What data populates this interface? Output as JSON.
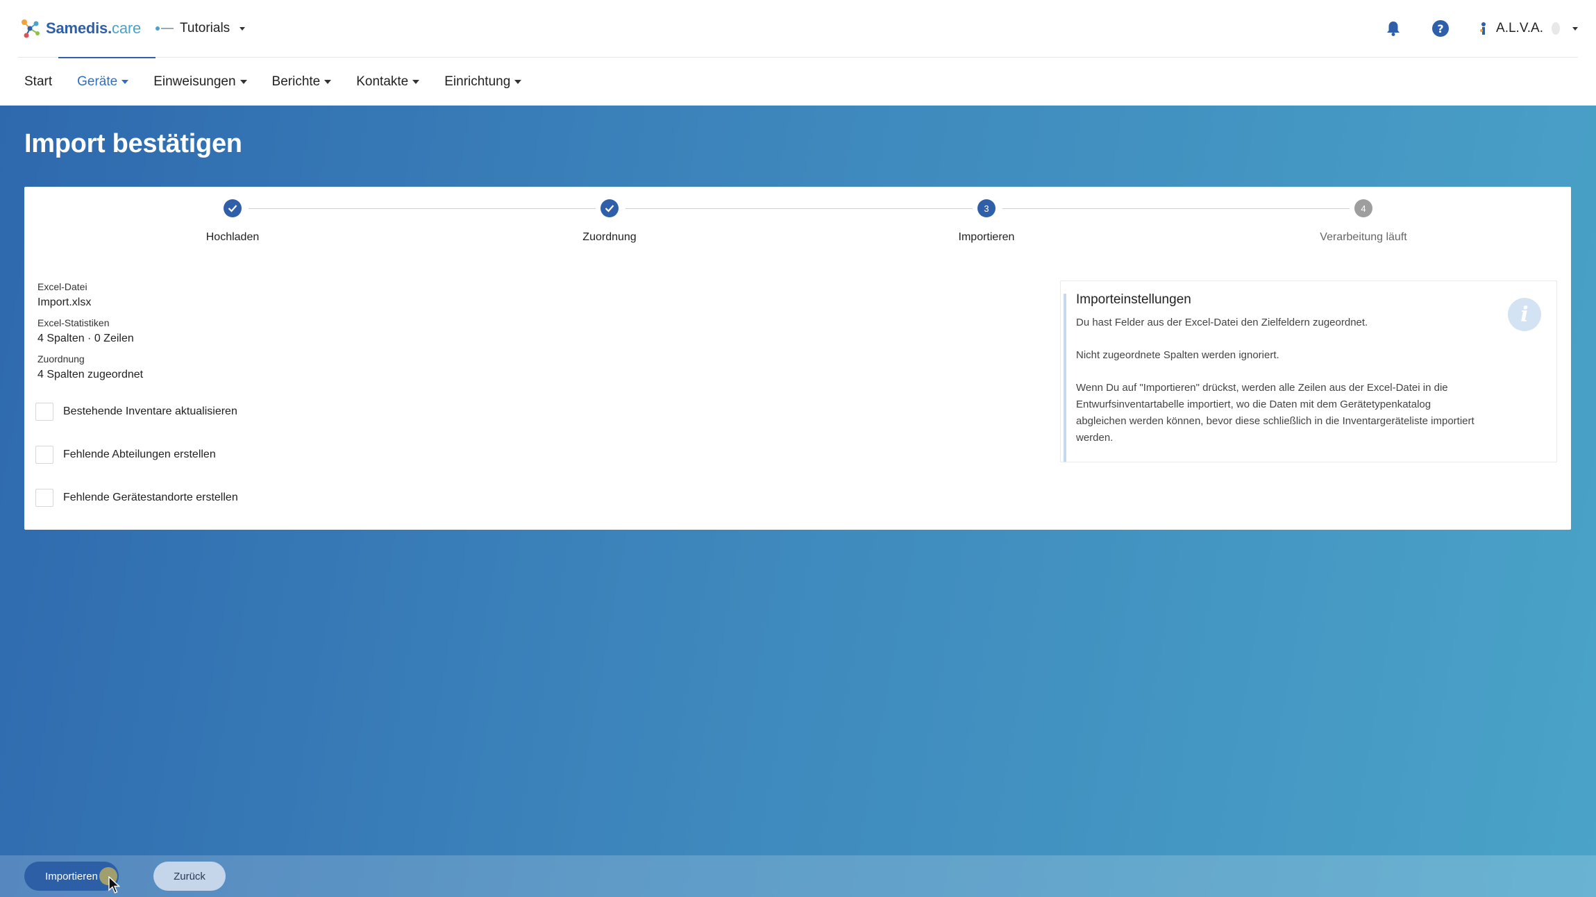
{
  "brand": {
    "name_main": "Samedis.",
    "name_suffix": "care"
  },
  "tenant": {
    "label": "Tutorials"
  },
  "user": {
    "name": "A.L.V.A."
  },
  "nav": {
    "items": [
      {
        "label": "Start"
      },
      {
        "label": "Geräte"
      },
      {
        "label": "Einweisungen"
      },
      {
        "label": "Berichte"
      },
      {
        "label": "Kontakte"
      },
      {
        "label": "Einrichtung"
      }
    ]
  },
  "page": {
    "title": "Import bestätigen"
  },
  "stepper": {
    "steps": [
      {
        "number": "1",
        "label": "Hochladen",
        "state": "done"
      },
      {
        "number": "2",
        "label": "Zuordnung",
        "state": "done"
      },
      {
        "number": "3",
        "label": "Importieren",
        "state": "active"
      },
      {
        "number": "4",
        "label": "Verarbeitung läuft",
        "state": "pending"
      }
    ]
  },
  "summary": {
    "file_label": "Excel-Datei",
    "file_value": "Import.xlsx",
    "stats_label": "Excel-Statistiken",
    "stats_value": "4 Spalten · 0 Zeilen",
    "mapping_label": "Zuordnung",
    "mapping_value": "4 Spalten zugeordnet"
  },
  "options": {
    "update_inventory": "Bestehende Inventare aktualisieren",
    "create_departments": "Fehlende Abteilungen erstellen",
    "create_locations": "Fehlende Gerätestandorte erstellen"
  },
  "info": {
    "title": "Importeinstellungen",
    "para1": "Du hast Felder aus der Excel-Datei den Zielfeldern zugeordnet.",
    "para2": "Nicht zugeordnete Spalten werden ignoriert.",
    "para3": "Wenn Du auf \"Importieren\" drückst, werden alle Zeilen aus der Excel-Datei in die Entwurfsinventartabelle importiert, wo die Daten mit dem Gerätetypenkatalog abgleichen werden können, bevor diese schließlich in die Inventargeräteliste importiert werden."
  },
  "actions": {
    "import": "Importieren",
    "back": "Zurück"
  },
  "colors": {
    "primary": "#2e5fa8",
    "accent": "#4aa3c8",
    "nav_active": "#2e6fc4"
  }
}
